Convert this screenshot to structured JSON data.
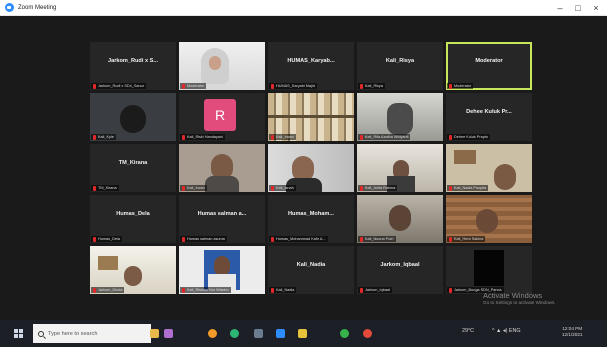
{
  "window": {
    "title": "Zoom Meeting",
    "minimize": "–",
    "maximize": "□",
    "close": "×"
  },
  "tiles": [
    {
      "name": "Jarkom_Rudi x S...",
      "label": "Jarkom_Rudi x SD4_Sanur",
      "video": false
    },
    {
      "name": "",
      "label": "Moderator",
      "video": true,
      "scene": "hijab"
    },
    {
      "name": "HUMAS_Karyab...",
      "label": "HUMAS_Karyabi Majid",
      "video": false
    },
    {
      "name": "Kali_Risya",
      "label": "Kali_Risya",
      "video": false
    },
    {
      "name": "Moderator",
      "label": "Moderator",
      "video": false,
      "active": true
    },
    {
      "name": "",
      "label": "Kali_Kyle",
      "video": true,
      "scene": "dark"
    },
    {
      "name": "",
      "label": "Kali_Riski Handayani",
      "video": false,
      "avatar": "R"
    },
    {
      "name": "",
      "label": "Kali_Irwan",
      "video": true,
      "scene": "shelf"
    },
    {
      "name": "",
      "label": "Kali_Rifa Azatha Widyanti",
      "video": true,
      "scene": "room"
    },
    {
      "name": "Dehee Kuluk Pr...",
      "label": "Dehee Kuluk Prapto",
      "video": false
    },
    {
      "name": "TM_Kirana",
      "label": "TM_Kirana",
      "video": false
    },
    {
      "name": "",
      "label": "Kali_Irwan",
      "video": true,
      "scene": "face"
    },
    {
      "name": "",
      "label": "Kali_Isnah",
      "video": true,
      "scene": "face2"
    },
    {
      "name": "",
      "label": "Kali_Anita Rahma",
      "video": true,
      "scene": "room2"
    },
    {
      "name": "",
      "label": "Kali_Nadia Puspita",
      "video": true,
      "scene": "shelf2"
    },
    {
      "name": "Humas_Dela",
      "label": "Humas_Dela",
      "video": false
    },
    {
      "name": "Humas salman a...",
      "label": "Humas salman asuma",
      "video": false
    },
    {
      "name": "Humas_Moham...",
      "label": "Humas_Mohammad Kafir A...",
      "video": false
    },
    {
      "name": "",
      "label": "Kali_Nouna Putri",
      "video": true,
      "scene": "wall"
    },
    {
      "name": "",
      "label": "Kali_Hera Sakina",
      "video": true,
      "scene": "wood"
    },
    {
      "name": "",
      "label": "Jarkom_Dinda",
      "video": true,
      "scene": "bright"
    },
    {
      "name": "",
      "label": "Kali_Riswan Nur Wasino",
      "video": true,
      "scene": "passport"
    },
    {
      "name": "Kali_Nadia",
      "label": "Kali_Nadia",
      "video": false
    },
    {
      "name": "Jarkom_Iqbaal",
      "label": "Jarkom_Iqbaal",
      "video": false
    },
    {
      "name": "",
      "label": "Jarkom_Bunga SDN_Panca",
      "video": true,
      "scene": "black"
    }
  ],
  "watermark": {
    "line1": "Activate Windows",
    "line2": "Go to Settings to activate Windows."
  },
  "taskbar": {
    "search_placeholder": "Type here to search",
    "weather": "29°C",
    "tray": "^ ▲ ◂) ENG",
    "time": "12:04 PM",
    "date": "12/1/2021"
  },
  "colors": {
    "accent_active": "#c6e65c",
    "stage_bg": "#1a1a1a",
    "tile_bg": "#262626",
    "muted_mic": "#e02828",
    "avatar_bg": "#e24c7d"
  }
}
